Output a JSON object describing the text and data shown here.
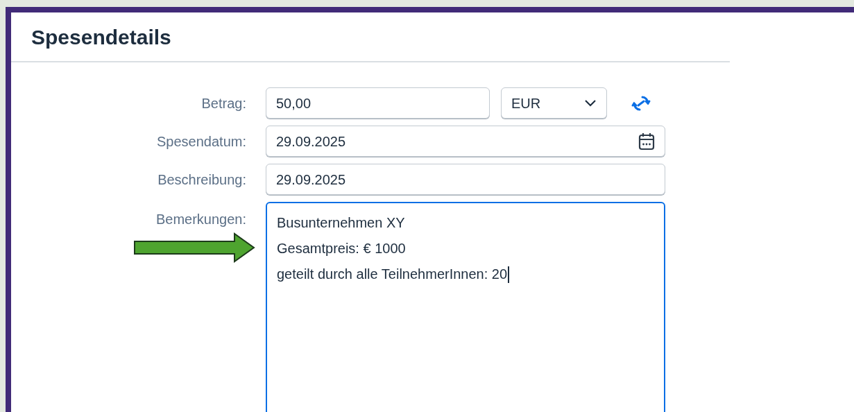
{
  "title": "Spesendetails",
  "fields": [
    {
      "kind": "amount",
      "label": "Betrag:",
      "value": "50,00",
      "currency": "EUR"
    },
    {
      "kind": "date",
      "label": "Spesendatum:",
      "value": "29.09.2025"
    },
    {
      "kind": "text",
      "label": "Beschreibung:",
      "value": "29.09.2025"
    },
    {
      "kind": "multiline",
      "label": "Bemerkungen:",
      "focused": true,
      "lines": [
        "Busunternehmen XY",
        "Gesamtpreis: € 1000",
        "geteilt durch alle TeilnehmerInnen: 20"
      ]
    }
  ]
}
